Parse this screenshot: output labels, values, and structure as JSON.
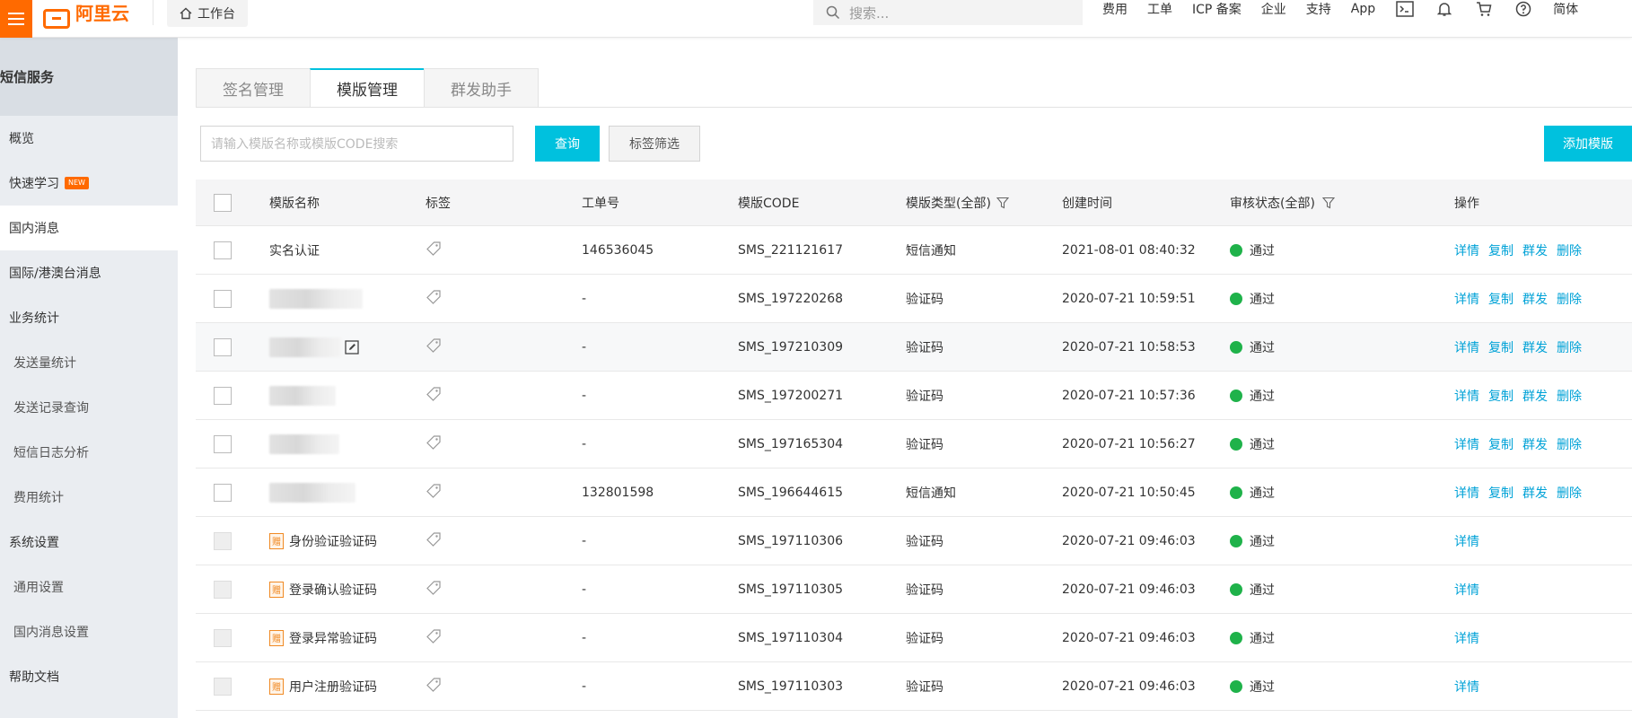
{
  "topbar": {
    "logo": "阿里云",
    "workbench": "工作台",
    "search_placeholder": "搜索...",
    "nav": [
      "费用",
      "工单",
      "ICP 备案",
      "企业",
      "支持",
      "App"
    ],
    "lang": "简体",
    "icons": [
      "terminal-icon",
      "bell-icon",
      "cart-icon",
      "help-icon"
    ]
  },
  "sidebar": {
    "title": "短信服务",
    "items": [
      {
        "label": "概览",
        "sub": false
      },
      {
        "label": "快速学习",
        "sub": false,
        "badge": "NEW"
      },
      {
        "label": "国内消息",
        "sub": false,
        "active": true
      },
      {
        "label": "国际/港澳台消息",
        "sub": false
      },
      {
        "label": "业务统计",
        "sub": false
      },
      {
        "label": "发送量统计",
        "sub": true
      },
      {
        "label": "发送记录查询",
        "sub": true
      },
      {
        "label": "短信日志分析",
        "sub": true
      },
      {
        "label": "费用统计",
        "sub": true
      },
      {
        "label": "系统设置",
        "sub": false
      },
      {
        "label": "通用设置",
        "sub": true
      },
      {
        "label": "国内消息设置",
        "sub": true
      },
      {
        "label": "帮助文档",
        "sub": false
      }
    ]
  },
  "tabs": [
    "签名管理",
    "模版管理",
    "群发助手"
  ],
  "toolbar": {
    "search_placeholder": "请输入模版名称或模版CODE搜索",
    "query": "查询",
    "tag_filter": "标签筛选",
    "add": "添加模版"
  },
  "table": {
    "headers": {
      "name": "模版名称",
      "tag": "标签",
      "ticket": "工单号",
      "code": "模版CODE",
      "type": "模版类型(全部)",
      "time": "创建时间",
      "status": "审核状态(全部)",
      "ops": "操作"
    },
    "rows": [
      {
        "name": "实名认证",
        "ticket": "146536045",
        "code": "SMS_221121617",
        "type": "短信通知",
        "time": "2021-08-01 08:40:32",
        "status": "通过",
        "ops": [
          "详情",
          "复制",
          "群发",
          "删除"
        ]
      },
      {
        "name": "",
        "ticket": "-",
        "code": "SMS_197220268",
        "type": "验证码",
        "time": "2020-07-21 10:59:51",
        "status": "通过",
        "ops": [
          "详情",
          "复制",
          "群发",
          "删除"
        ]
      },
      {
        "name": "",
        "ticket": "-",
        "code": "SMS_197210309",
        "type": "验证码",
        "time": "2020-07-21 10:58:53",
        "status": "通过",
        "ops": [
          "详情",
          "复制",
          "群发",
          "删除"
        ]
      },
      {
        "name": "",
        "ticket": "-",
        "code": "SMS_197200271",
        "type": "验证码",
        "time": "2020-07-21 10:57:36",
        "status": "通过",
        "ops": [
          "详情",
          "复制",
          "群发",
          "删除"
        ]
      },
      {
        "name": "",
        "ticket": "-",
        "code": "SMS_197165304",
        "type": "验证码",
        "time": "2020-07-21 10:56:27",
        "status": "通过",
        "ops": [
          "详情",
          "复制",
          "群发",
          "删除"
        ]
      },
      {
        "name": "",
        "ticket": "132801598",
        "code": "SMS_196644615",
        "type": "短信通知",
        "time": "2020-07-21 10:50:45",
        "status": "通过",
        "ops": [
          "详情",
          "复制",
          "群发",
          "删除"
        ]
      },
      {
        "name": "身份验证验证码",
        "ticket": "-",
        "code": "SMS_197110306",
        "type": "验证码",
        "time": "2020-07-21 09:46:03",
        "status": "通过",
        "ops": [
          "详情"
        ],
        "gift": "赠"
      },
      {
        "name": "登录确认验证码",
        "ticket": "-",
        "code": "SMS_197110305",
        "type": "验证码",
        "time": "2020-07-21 09:46:03",
        "status": "通过",
        "ops": [
          "详情"
        ],
        "gift": "赠"
      },
      {
        "name": "登录异常验证码",
        "ticket": "-",
        "code": "SMS_197110304",
        "type": "验证码",
        "time": "2020-07-21 09:46:03",
        "status": "通过",
        "ops": [
          "详情"
        ],
        "gift": "赠"
      },
      {
        "name": "用户注册验证码",
        "ticket": "-",
        "code": "SMS_197110303",
        "type": "验证码",
        "time": "2020-07-21 09:46:03",
        "status": "通过",
        "ops": [
          "详情"
        ],
        "gift": "赠"
      }
    ]
  },
  "colors": {
    "brand": "#ff6a00",
    "accent": "#00c1de",
    "link": "#00a2d7",
    "status_ok": "#1fb24a"
  }
}
